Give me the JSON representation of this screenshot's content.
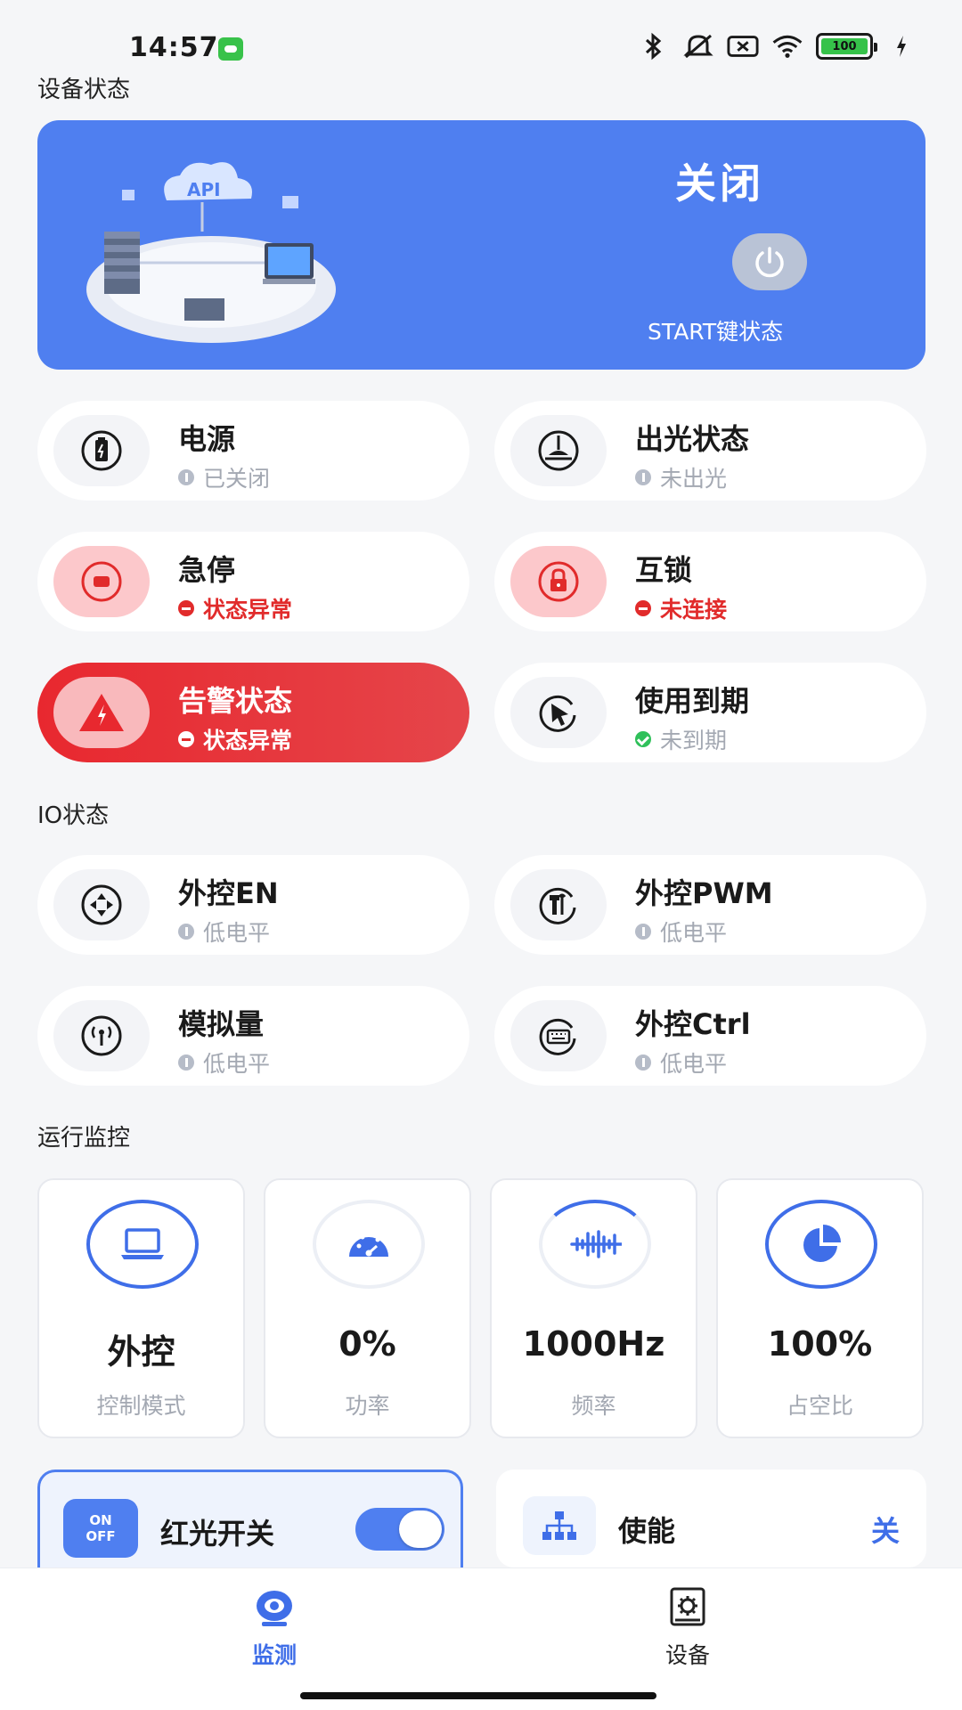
{
  "status_bar": {
    "time": "14:57",
    "battery": "100"
  },
  "sections": {
    "device_status": "设备状态",
    "io_status": "IO状态",
    "run_monitor": "运行监控"
  },
  "hero": {
    "state": "关闭",
    "caption": "START键状态",
    "api_label": "API"
  },
  "device_cards": [
    {
      "title": "电源",
      "sub": "已关闭",
      "status": "info"
    },
    {
      "title": "出光状态",
      "sub": "未出光",
      "status": "info"
    },
    {
      "title": "急停",
      "sub": "状态异常",
      "status": "error"
    },
    {
      "title": "互锁",
      "sub": "未连接",
      "status": "error"
    },
    {
      "title": "告警状态",
      "sub": "状态异常",
      "status": "alarm"
    },
    {
      "title": "使用到期",
      "sub": "未到期",
      "status": "ok"
    }
  ],
  "io_cards": [
    {
      "title": "外控EN",
      "sub": "低电平"
    },
    {
      "title": "外控PWM",
      "sub": "低电平"
    },
    {
      "title": "模拟量",
      "sub": "低电平"
    },
    {
      "title": "外控Ctrl",
      "sub": "低电平"
    }
  ],
  "monitor": [
    {
      "value": "外控",
      "label": "控制模式"
    },
    {
      "value": "0%",
      "label": "功率"
    },
    {
      "value": "1000Hz",
      "label": "频率"
    },
    {
      "value": "100%",
      "label": "占空比"
    }
  ],
  "controls": {
    "red_light": {
      "badge_top": "ON",
      "badge_bottom": "OFF",
      "label": "红光开关",
      "enabled": true
    },
    "enable": {
      "label": "使能",
      "value": "关"
    }
  },
  "tabs": [
    {
      "label": "监测",
      "active": true
    },
    {
      "label": "设备",
      "active": false
    }
  ],
  "colors": {
    "accent": "#4f7ff0",
    "danger": "#e12b2b",
    "ok": "#2fc05a",
    "muted": "#a3a8b2"
  }
}
